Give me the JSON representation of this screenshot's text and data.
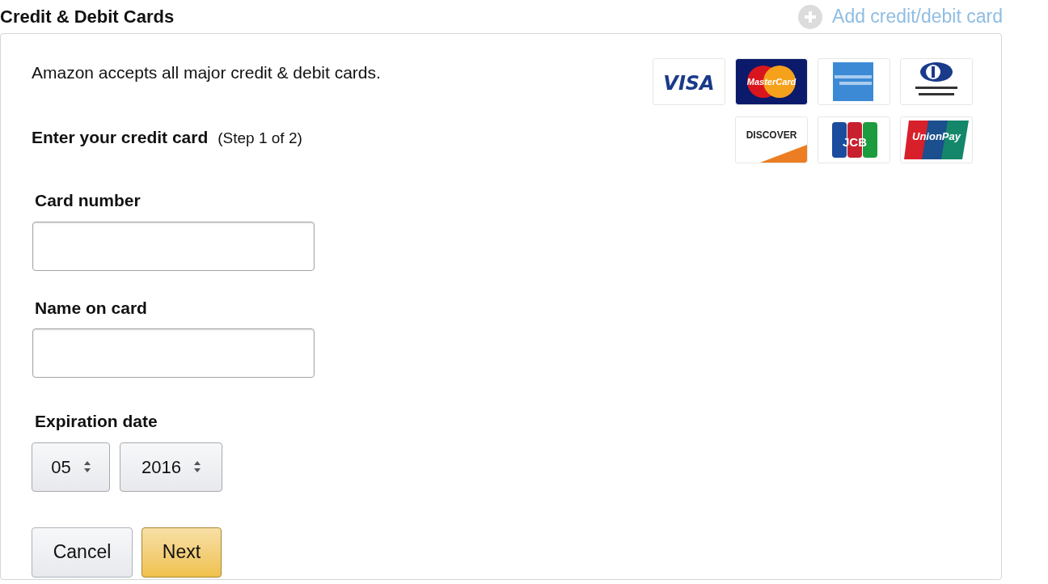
{
  "header": {
    "title": "Credit & Debit Cards",
    "add_link": "Add credit/debit card"
  },
  "intro": "Amazon accepts all major credit & debit cards.",
  "card_logos": [
    {
      "kind": "visa",
      "label": "VISA"
    },
    {
      "kind": "mastercard",
      "label": "MasterCard"
    },
    {
      "kind": "amex"
    },
    {
      "kind": "diners"
    },
    {
      "kind": "discover",
      "label": "DISCOVER"
    },
    {
      "kind": "jcb",
      "label": "JCB"
    },
    {
      "kind": "unionpay",
      "label": "UnionPay"
    }
  ],
  "form": {
    "heading": "Enter your credit card",
    "step": "(Step 1 of 2)",
    "fields": [
      {
        "label": "Card number"
      },
      {
        "label": "Name on card"
      }
    ],
    "expiration": {
      "label": "Expiration date",
      "month": "05",
      "year": "2016"
    },
    "buttons": [
      {
        "label": "Cancel",
        "kind": "secondary"
      },
      {
        "label": "Next",
        "kind": "primary"
      }
    ]
  }
}
